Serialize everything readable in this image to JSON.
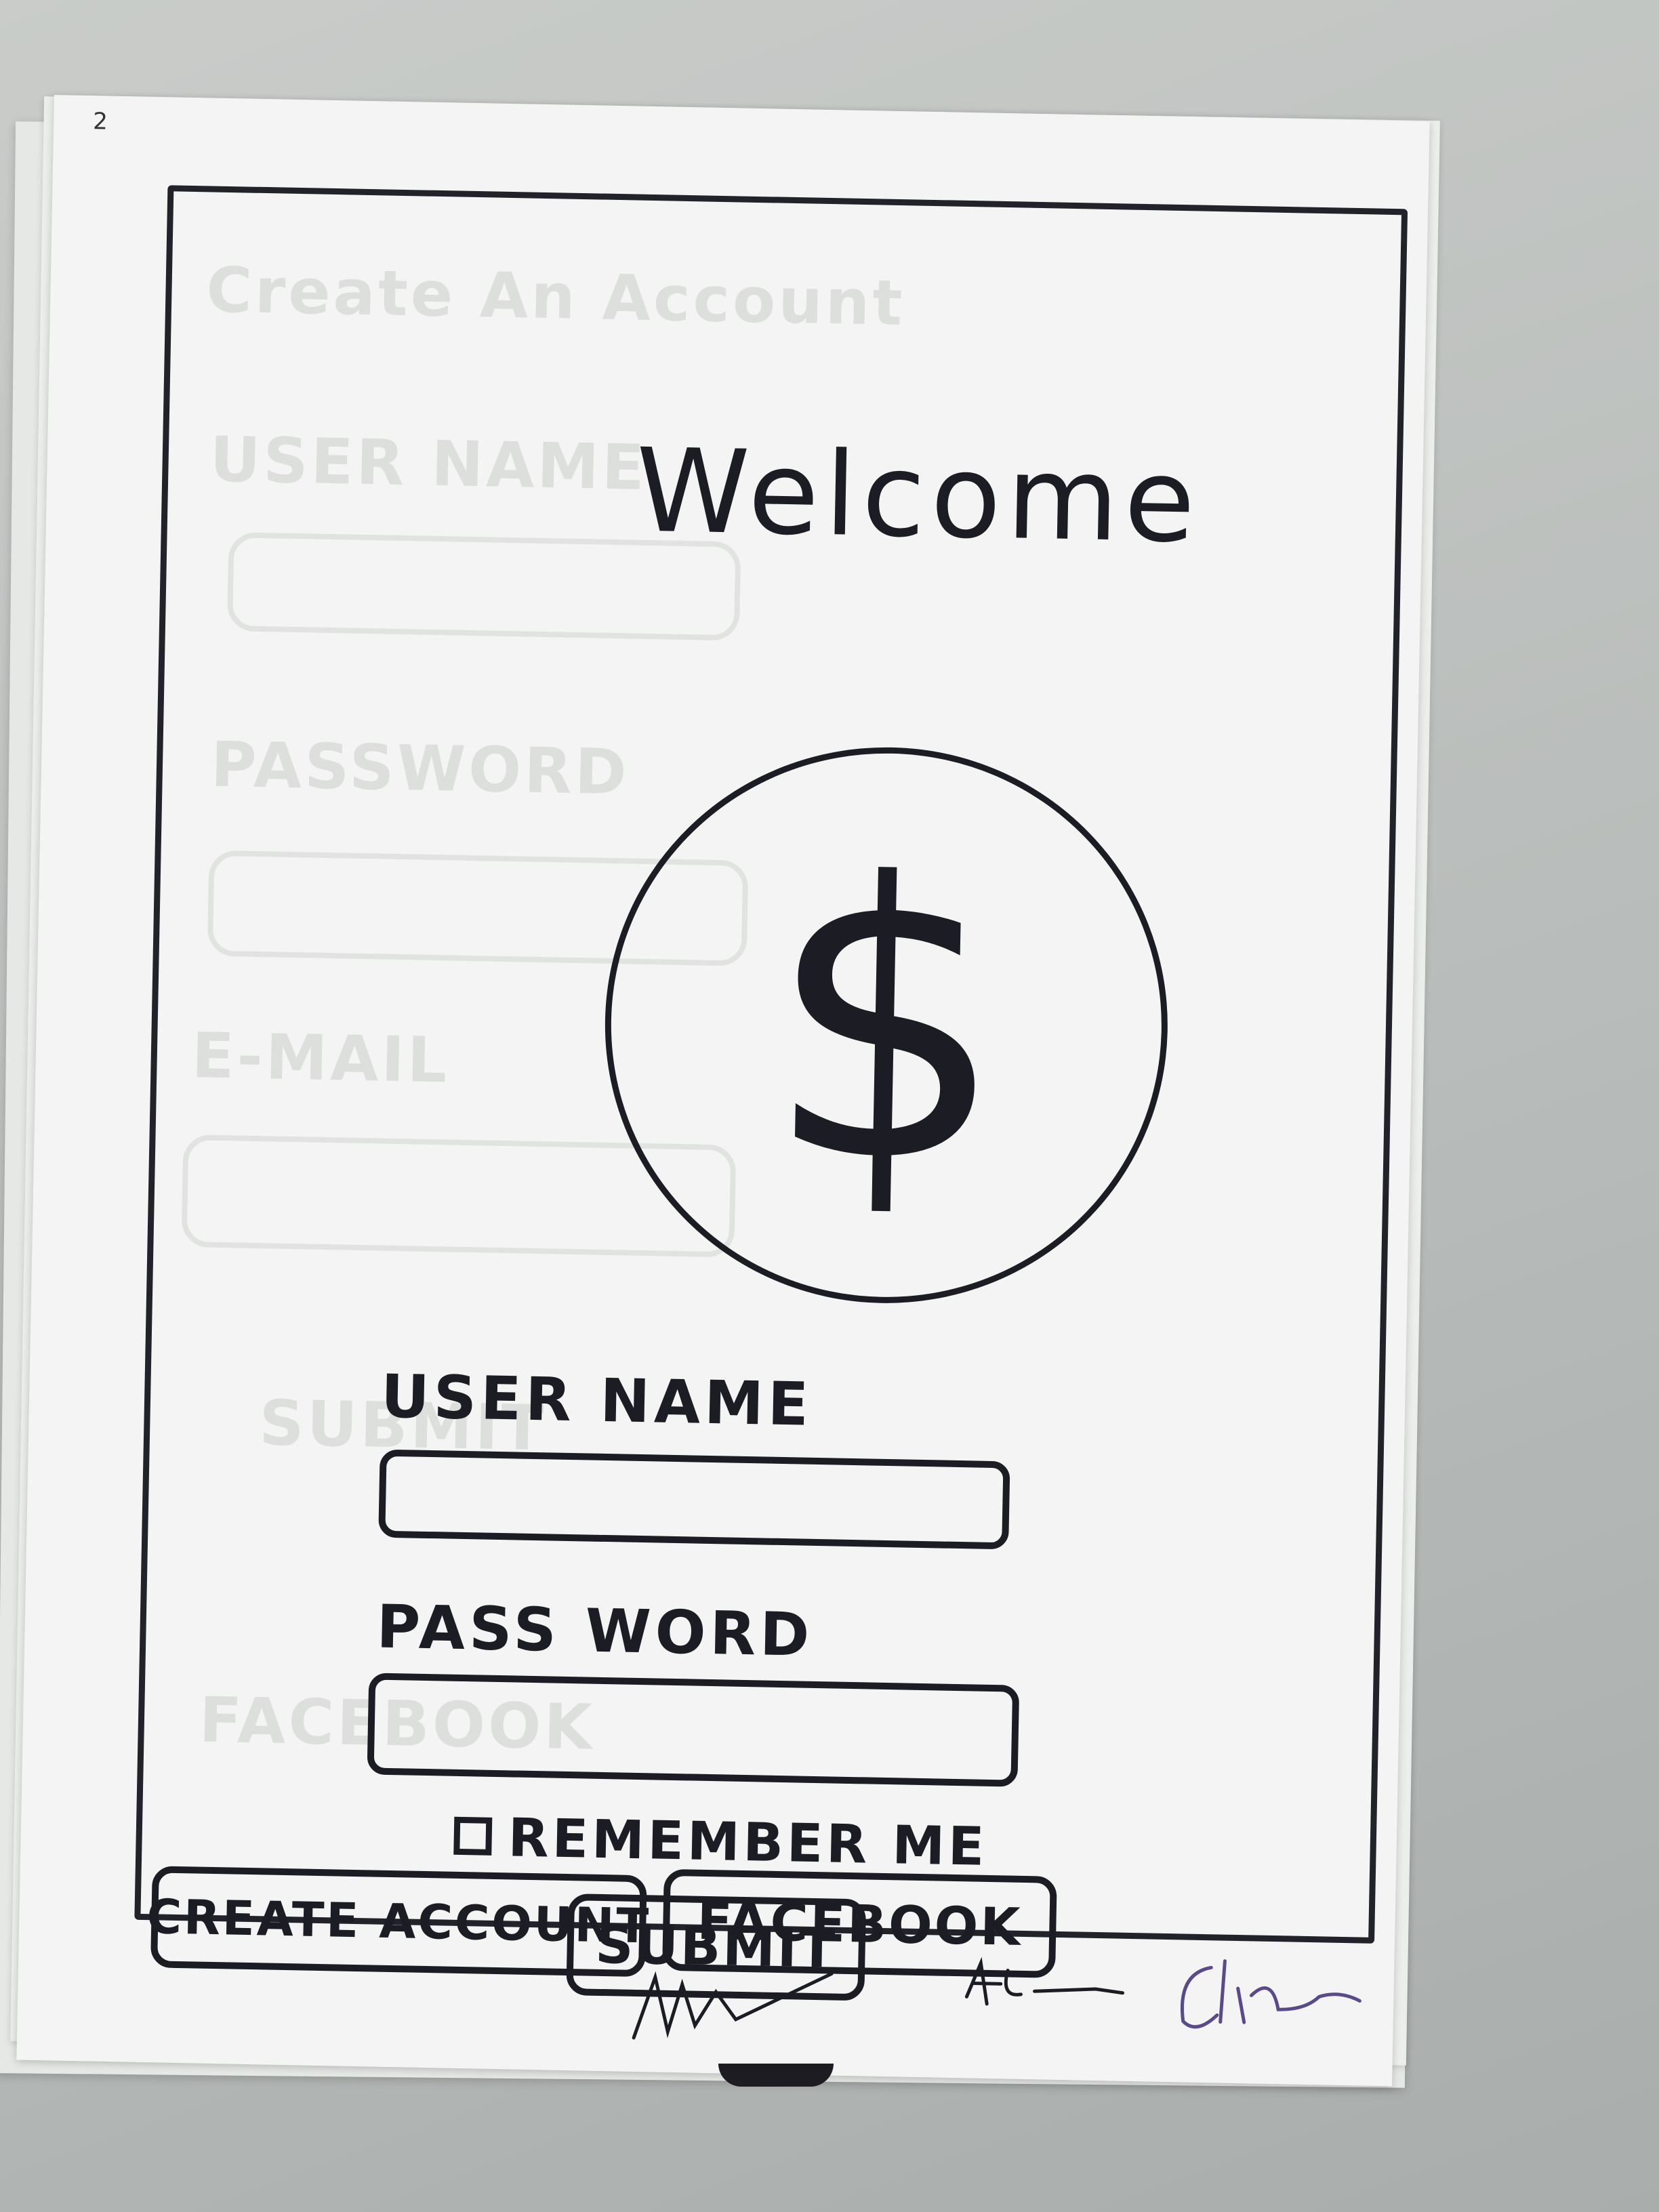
{
  "sheet": {
    "page_number": "2"
  },
  "ghost_page": {
    "title": "Create An Account",
    "fields": [
      "USER NAME",
      "PASSWORD",
      "E-MAIL"
    ],
    "buttons": [
      "SUBMIT",
      "FACEBOOK"
    ]
  },
  "screen": {
    "title": "Welcome",
    "logo_symbol": "$",
    "logo_icon": "dollar-icon",
    "username": {
      "label": "USER NAME",
      "value": ""
    },
    "password": {
      "label": "PASS WORD",
      "value": ""
    },
    "remember_me": {
      "label": "REMEMBER ME",
      "checked": false
    },
    "buttons": {
      "submit": "SUBMIT",
      "create_account": "CREATE ACCOUNT",
      "facebook": "FACEBOOK"
    }
  },
  "signatures": [
    "signature-1",
    "signature-2",
    "signature-3"
  ],
  "colors": {
    "ink": "#1c1c24",
    "paper": "#f3f4f3",
    "desk": "#b8bcba",
    "signature_purple": "#5a4a8a"
  }
}
